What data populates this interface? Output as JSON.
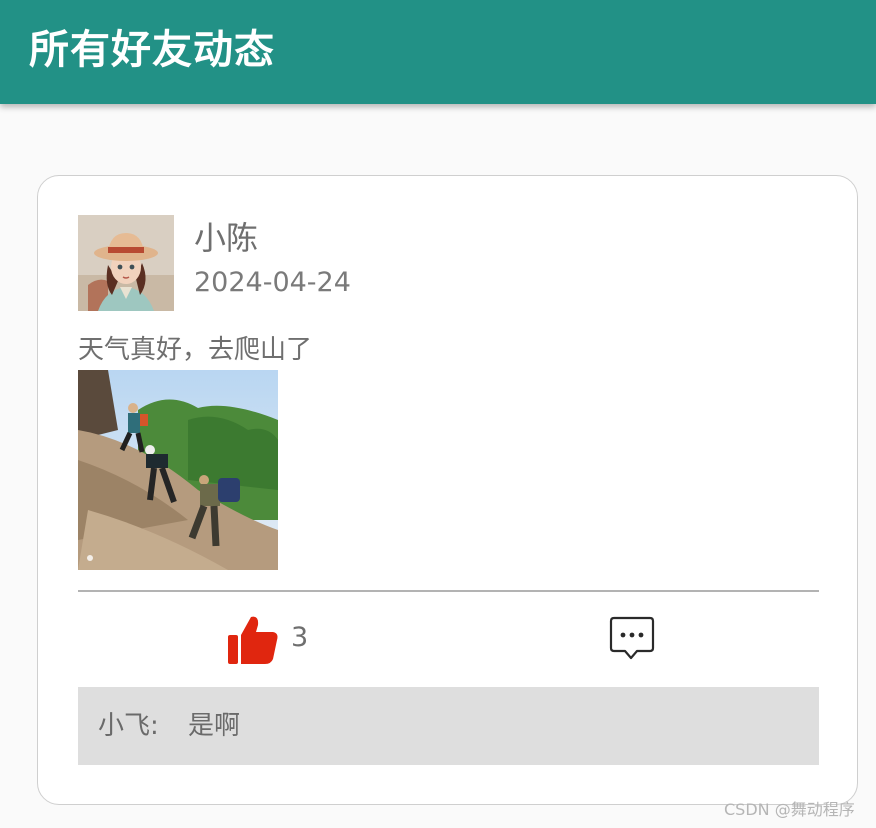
{
  "app_bar": {
    "title": "所有好友动态",
    "color": "#229186"
  },
  "post": {
    "author": "小陈",
    "date": "2024-04-24",
    "text": "天气真好，去爬山了",
    "avatar_icon": "avatar-girl-straw-hat",
    "photo_icon": "mountain-hiking-photo",
    "like_icon": "thumbs-up-icon",
    "like_color": "#e0260f",
    "like_count": "3",
    "comment_icon": "comment-bubble-icon",
    "comments": [
      {
        "author": "小飞:",
        "text": "是啊"
      }
    ]
  },
  "watermark": "CSDN @舞动程序"
}
